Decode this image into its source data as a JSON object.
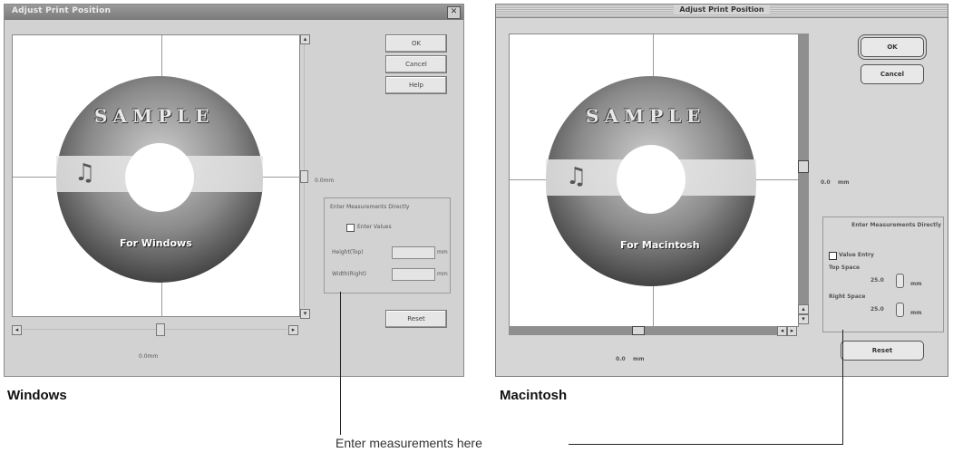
{
  "windows": {
    "title": "Adjust Print Position",
    "close_glyph": "✕",
    "ok": "OK",
    "cancel": "Cancel",
    "help": "Help",
    "reset": "Reset",
    "vertical_value": "0.0mm",
    "horizontal_value": "0.0mm",
    "group_title": "Enter Measurements Directly",
    "enter_values": "Enter Values",
    "height_label": "Height(Top)",
    "width_label": "Width(Right)",
    "unit": "mm",
    "cd_title": "SAMPLE",
    "cd_label": "For Windows",
    "scroll_left": "◂",
    "scroll_right": "▸",
    "scroll_up": "▴",
    "scroll_down": "▾"
  },
  "mac": {
    "title": "Adjust Print Position",
    "ok": "OK",
    "cancel": "Cancel",
    "reset": "Reset",
    "vertical_value": "0.0",
    "horizontal_value": "0.0",
    "unit": "mm",
    "group_title": "Enter Measurements Directly",
    "value_entry": "Value Entry",
    "top_space": "Top Space",
    "right_space": "Right Space",
    "top_value": "25.0",
    "right_value": "25.0",
    "cd_title": "SAMPLE",
    "cd_label": "For Macintosh",
    "scroll_left": "◂",
    "scroll_right": "▸",
    "scroll_up": "▴",
    "scroll_down": "▾"
  },
  "captions": {
    "windows": "Windows",
    "mac": "Macintosh",
    "callout": "Enter measurements here"
  },
  "colors": {
    "cd_dark": "#3c3c3c",
    "cd_mid": "#8a8a8a",
    "cd_light": "#cfcfcf"
  },
  "icons": {
    "music_note": "♫"
  }
}
